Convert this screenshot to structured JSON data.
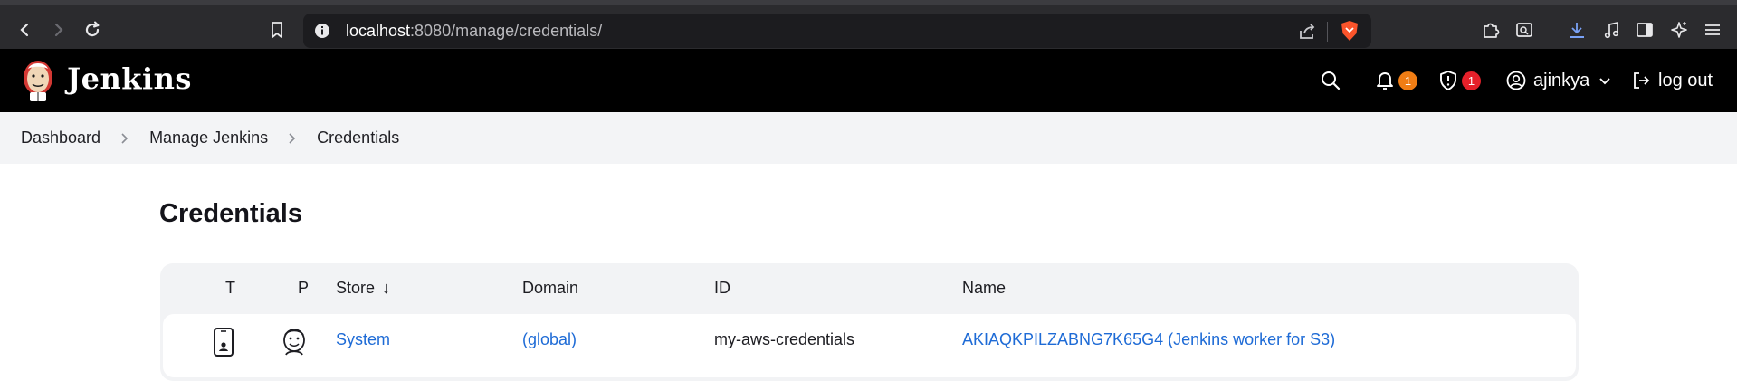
{
  "browser": {
    "url_host": "localhost",
    "url_path": ":8080/manage/credentials/"
  },
  "header": {
    "app_title": "Jenkins",
    "notifications_count": "1",
    "security_count": "1",
    "username": "ajinkya",
    "logout_label": "log out"
  },
  "breadcrumb": {
    "items": [
      "Dashboard",
      "Manage Jenkins",
      "Credentials"
    ]
  },
  "page": {
    "title": "Credentials"
  },
  "table": {
    "columns": {
      "t": "T",
      "p": "P",
      "store": "Store",
      "store_sort": "↓",
      "domain": "Domain",
      "id": "ID",
      "name": "Name"
    },
    "rows": [
      {
        "store": "System",
        "domain": "(global)",
        "id": "my-aws-credentials",
        "name": "AKIAQKPILZABNG7K65G4 (Jenkins worker for S3)"
      }
    ]
  },
  "colors": {
    "link": "#1e6bd6",
    "header_bg": "#000000",
    "badge_orange": "#f07d14",
    "badge_red": "#e5202a"
  }
}
